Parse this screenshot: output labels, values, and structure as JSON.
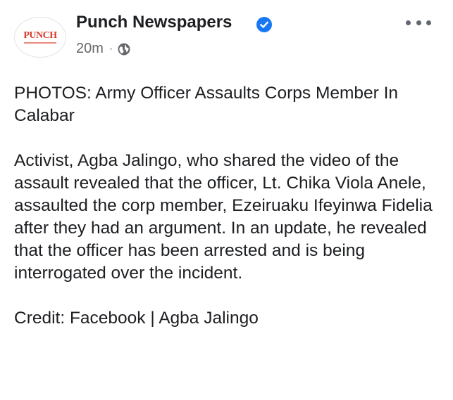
{
  "post": {
    "author": {
      "name": "Punch Newspapers",
      "logo_text": "PUNCH",
      "verified": true
    },
    "meta": {
      "time": "20m",
      "separator": "·",
      "audience_icon": "globe-icon"
    },
    "menu_icon": "more-options-icon",
    "content": {
      "headline": "PHOTOS: Army Officer Assaults Corps Member In Calabar",
      "body": "Activist, Agba Jalingo, who shared the video of the assault revealed that the officer, Lt. Chika Viola Anele, assaulted the corp member, Ezeiruaku Ifeyinwa Fidelia after they had an argument.  In an update, he revealed that the officer has been arrested and is being interrogated over the incident.",
      "credit": "Credit: Facebook  | Agba Jalingo"
    },
    "colors": {
      "text": "#1c1e21",
      "secondary_text": "#65676b",
      "verified_badge": "#1877f2",
      "logo_red": "#d93a2b"
    }
  }
}
